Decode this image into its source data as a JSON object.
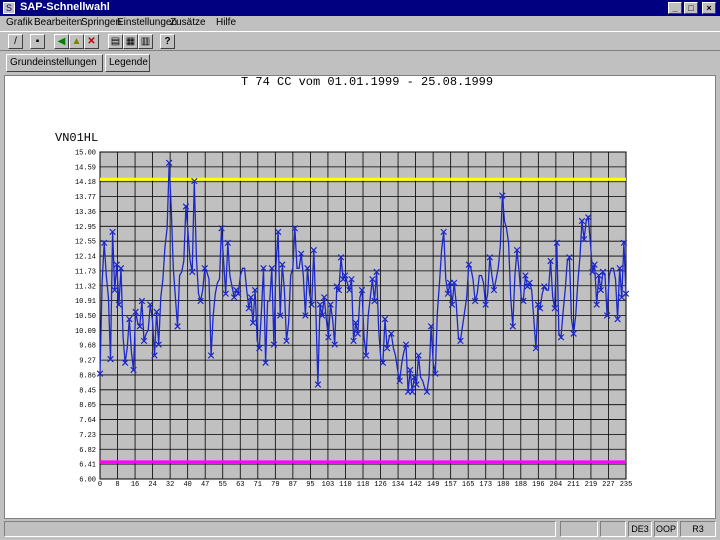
{
  "window": {
    "title": "SAP-Schnellwahl"
  },
  "menu": [
    {
      "label": "Grafik"
    },
    {
      "label": "Bearbeiten"
    },
    {
      "label": "Springen"
    },
    {
      "label": "Einstellungen"
    },
    {
      "label": "Zusätze"
    },
    {
      "label": "Hilfe"
    }
  ],
  "buttons": {
    "grundeinstellungen": "Grundeinstellungen",
    "legende": "Legende"
  },
  "header_line": "T 74 CC vom 01.01.1999 - 25.08.1999",
  "status": {
    "f2": "DE3",
    "f3": "OOP",
    "f4": "R3"
  },
  "colors": {
    "series": "#1c28c8",
    "upper_limit": "#ffff00",
    "lower_limit": "#ff00ff",
    "plot_bg": "#c0c0c0"
  },
  "chart_data": {
    "type": "line",
    "title": "VN01HL",
    "ylim": [
      6.0,
      15.0
    ],
    "yticks": [
      "15.00",
      "14.59",
      "14.18",
      "13.77",
      "13.36",
      "12.95",
      "12.55",
      "12.14",
      "11.73",
      "11.32",
      "10.91",
      "10.50",
      "10.09",
      "9.68",
      "9.27",
      "8.86",
      "8.45",
      "8.05",
      "7.64",
      "7.23",
      "6.82",
      "6.41",
      "6.00"
    ],
    "xlim": [
      0,
      240
    ],
    "xticks": [
      "0",
      "8",
      "16",
      "24",
      "32",
      "40",
      "47",
      "55",
      "63",
      "71",
      "79",
      "87",
      "95",
      "103",
      "110",
      "118",
      "126",
      "134",
      "142",
      "149",
      "157",
      "165",
      "173",
      "180",
      "188",
      "196",
      "204",
      "211",
      "219",
      "227",
      "235"
    ],
    "upper_limit": 14.25,
    "lower_limit": 6.47,
    "y": [
      8.9,
      11.4,
      12.5,
      11.6,
      11.0,
      9.3,
      12.8,
      11.2,
      11.9,
      10.8,
      11.8,
      9.9,
      9.2,
      9.6,
      10.4,
      9.5,
      9.0,
      10.6,
      10.3,
      10.2,
      10.9,
      9.8,
      10.0,
      10.1,
      10.8,
      10.4,
      9.4,
      10.6,
      9.7,
      11.0,
      11.5,
      12.4,
      12.9,
      14.7,
      13.4,
      11.8,
      11.0,
      10.2,
      11.6,
      11.7,
      12.0,
      13.5,
      12.8,
      12.0,
      11.7,
      14.2,
      12.1,
      11.1,
      10.9,
      11.2,
      11.8,
      11.7,
      11.5,
      9.4,
      10.5,
      11.1,
      11.4,
      11.5,
      12.9,
      12.0,
      11.1,
      12.5,
      11.6,
      11.3,
      11.0,
      11.2,
      11.1,
      11.6,
      11.8,
      11.8,
      11.2,
      10.7,
      11.0,
      10.3,
      11.2,
      9.8,
      9.6,
      10.6,
      11.8,
      9.2,
      10.9,
      10.9,
      11.8,
      9.7,
      11.9,
      12.8,
      10.5,
      11.9,
      11.2,
      9.8,
      10.3,
      11.6,
      11.8,
      12.9,
      11.8,
      11.8,
      12.2,
      11.6,
      10.5,
      11.8,
      11.1,
      10.8,
      12.3,
      10.7,
      8.6,
      10.8,
      10.5,
      11.0,
      10.4,
      9.9,
      10.8,
      10.4,
      9.7,
      11.3,
      11.2,
      12.1,
      11.5,
      11.6,
      11.4,
      11.2,
      11.5,
      9.8,
      10.3,
      10.0,
      11.0,
      11.2,
      9.9,
      9.4,
      10.5,
      11.0,
      11.5,
      10.9,
      11.7,
      10.1,
      9.3,
      9.2,
      10.4,
      9.6,
      9.9,
      10.0,
      9.6,
      9.4,
      9.0,
      8.7,
      9.2,
      9.5,
      9.7,
      8.4,
      9.0,
      8.4,
      8.8,
      8.6,
      9.4,
      8.8,
      8.7,
      8.5,
      8.4,
      8.8,
      10.2,
      9.2,
      8.9,
      10.6,
      11.4,
      12.3,
      12.8,
      11.5,
      11.1,
      11.4,
      10.8,
      11.4,
      10.8,
      9.9,
      9.8,
      10.2,
      10.6,
      11.0,
      11.9,
      11.8,
      11.5,
      10.9,
      11.1,
      11.6,
      11.6,
      11.4,
      10.8,
      11.1,
      12.1,
      11.6,
      11.2,
      11.5,
      11.8,
      12.4,
      13.8,
      13.1,
      12.9,
      12.5,
      11.0,
      10.2,
      11.6,
      12.3,
      11.7,
      11.0,
      10.9,
      11.6,
      11.3,
      11.4,
      11.2,
      10.4,
      9.6,
      10.8,
      10.7,
      11.1,
      11.3,
      11.2,
      11.2,
      12.0,
      11.0,
      10.7,
      12.5,
      10.0,
      9.9,
      10.6,
      11.2,
      12.0,
      12.1,
      10.4,
      10.0,
      10.5,
      11.4,
      12.1,
      13.1,
      12.6,
      13.1,
      13.2,
      12.5,
      11.7,
      11.9,
      10.8,
      11.6,
      11.2,
      11.7,
      11.6,
      10.5,
      11.6,
      11.8,
      11.8,
      11.5,
      10.4,
      11.8,
      11.0,
      12.5,
      11.1
    ]
  }
}
